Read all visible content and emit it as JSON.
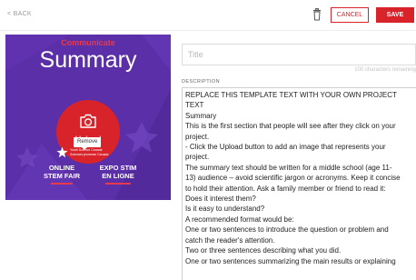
{
  "toolbar": {
    "back_label": "< BACK",
    "trash_icon": "trash-icon",
    "cancel_label": "CANCEL",
    "save_label": "SAVE",
    "accent_color": "#d8232a"
  },
  "cover": {
    "heading_small": "Communicate",
    "heading_large": "Summary",
    "upload_label": "Upload",
    "remove_label": "Remove",
    "logo_lines": [
      "Youth Science Canada",
      "Sciences jeunesse Canada"
    ],
    "fair_left": [
      "ONLINE",
      "STEM FAIR"
    ],
    "fair_right": [
      "EXPO STIM",
      "EN LIGNE"
    ],
    "background_color": "#5a2fa8"
  },
  "form": {
    "title_placeholder": "Title",
    "char_count": "100 characters remaining",
    "description_label": "DESCRIPTION",
    "description_lines": [
      "REPLACE THIS TEMPLATE TEXT WITH YOUR OWN PROJECT",
      "TEXT",
      "Summary",
      "This is the first section that people will see after they click on your",
      "project.",
      "- Click the Upload button to add an image that represents your",
      "project.",
      "The summary text should be written for a middle school (age 11-",
      "13) audience – avoid scientific jargon or acronyms. Keep it concise",
      "to hold their attention. Ask a family member or friend to read it:",
      "Does it interest them?",
      "Is it easy to understand?",
      "A recommended format would be:",
      "One or two sentences to introduce the question or problem and",
      "catch the reader's attention.",
      "Two or three sentences describing what you did.",
      "One or two sentences summarizing the main results or explaining"
    ]
  }
}
